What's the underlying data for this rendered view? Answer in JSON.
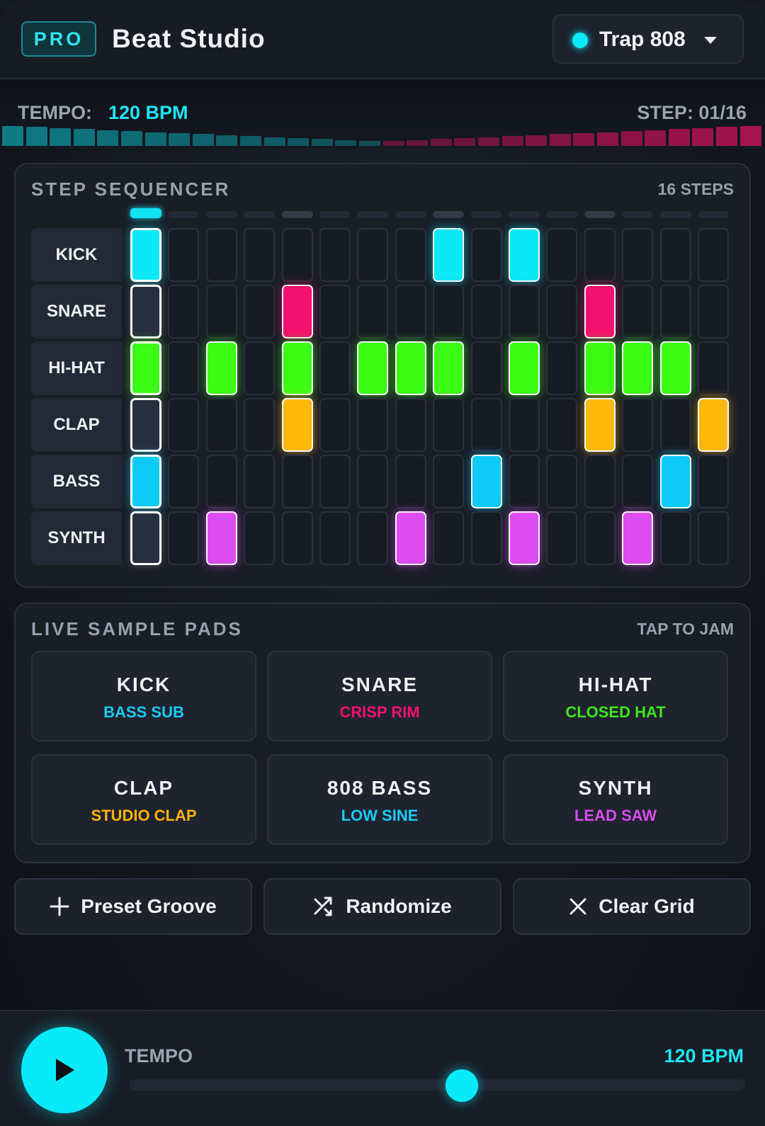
{
  "header": {
    "badge": "PRO",
    "title": "Beat Studio",
    "kit": "Trap 808"
  },
  "info": {
    "tempo_label": "TEMPO:",
    "tempo_value": "120 BPM",
    "step": "STEP: 01/16"
  },
  "sequencer": {
    "title": "STEP SEQUENCER",
    "meta": "16 STEPS",
    "current_step": 1,
    "rows": [
      {
        "label": "KICK",
        "color": "#0de8f6",
        "steps": [
          1,
          0,
          0,
          0,
          0,
          0,
          0,
          0,
          1,
          0,
          1,
          0,
          0,
          0,
          0,
          0
        ]
      },
      {
        "label": "SNARE",
        "color": "#f5116f",
        "steps": [
          0,
          0,
          0,
          0,
          1,
          0,
          0,
          0,
          0,
          0,
          0,
          0,
          1,
          0,
          0,
          0
        ]
      },
      {
        "label": "HI-HAT",
        "color": "#3dfd17",
        "steps": [
          1,
          0,
          1,
          0,
          1,
          0,
          1,
          1,
          1,
          0,
          1,
          0,
          1,
          1,
          1,
          0
        ]
      },
      {
        "label": "CLAP",
        "color": "#ffb80a",
        "steps": [
          0,
          0,
          0,
          0,
          1,
          0,
          0,
          0,
          0,
          0,
          0,
          0,
          1,
          0,
          0,
          1
        ]
      },
      {
        "label": "BASS",
        "color": "#0dcaf6",
        "steps": [
          1,
          0,
          0,
          0,
          0,
          0,
          0,
          0,
          0,
          1,
          0,
          0,
          0,
          0,
          1,
          0
        ]
      },
      {
        "label": "SYNTH",
        "color": "#dd4cf1",
        "steps": [
          0,
          0,
          1,
          0,
          0,
          0,
          0,
          1,
          0,
          0,
          1,
          0,
          0,
          1,
          0,
          0
        ]
      }
    ]
  },
  "pads": {
    "title": "LIVE SAMPLE PADS",
    "meta": "TAP TO JAM",
    "items": [
      {
        "name": "KICK",
        "sub": "BASS SUB",
        "color": "#1ccaf2"
      },
      {
        "name": "SNARE",
        "sub": "CRISP RIM",
        "color": "#f5116f"
      },
      {
        "name": "HI-HAT",
        "sub": "CLOSED HAT",
        "color": "#3de81a"
      },
      {
        "name": "CLAP",
        "sub": "STUDIO CLAP",
        "color": "#ffb20a"
      },
      {
        "name": "808 BASS",
        "sub": "LOW SINE",
        "color": "#1ccaf2"
      },
      {
        "name": "SYNTH",
        "sub": "LEAD SAW",
        "color": "#d94cf1"
      }
    ]
  },
  "actions": {
    "preset": "Preset Groove",
    "randomize": "Randomize",
    "clear": "Clear Grid"
  },
  "transport": {
    "label": "TEMPO",
    "value": "120 BPM",
    "slider_fraction": 0.54,
    "accent": "#08eaf8"
  },
  "icons": {
    "preset": "plus-icon",
    "randomize": "shuffle-icon",
    "clear": "close-icon",
    "play": "play-icon",
    "kit": "chevron-down-icon"
  }
}
